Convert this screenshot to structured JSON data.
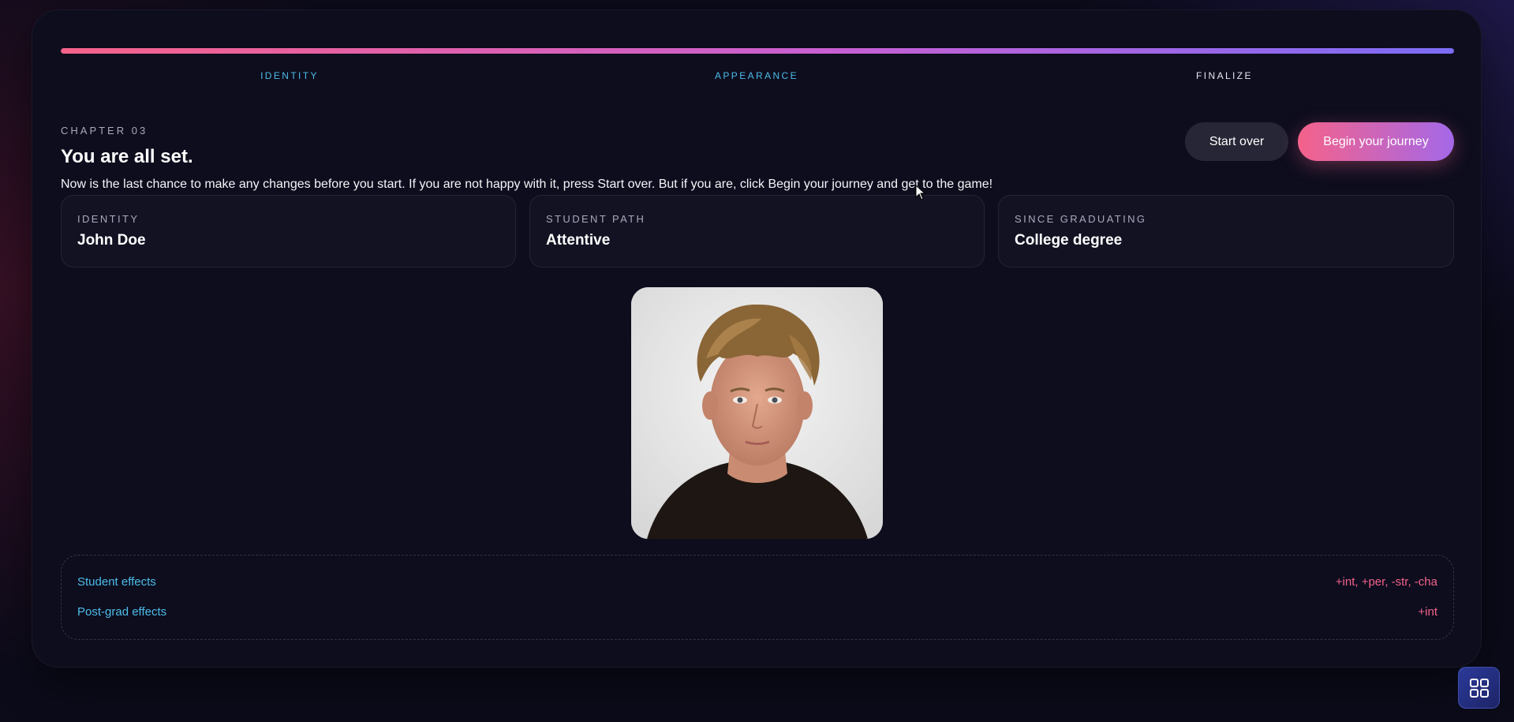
{
  "progress": {
    "fraction": 1.0,
    "colors": [
      "#f5628a",
      "#7b6cf6"
    ]
  },
  "steps": [
    {
      "label": "IDENTITY",
      "state": "done"
    },
    {
      "label": "APPEARANCE",
      "state": "done"
    },
    {
      "label": "FINALIZE",
      "state": "current"
    }
  ],
  "header": {
    "chapter": "CHAPTER 03",
    "title": "You are all set.",
    "description": "Now is the last chance to make any changes before you start. If you are not happy with it, press Start over. But if you are, click Begin your journey and get to the game!"
  },
  "actions": {
    "start_over": "Start over",
    "begin": "Begin your journey"
  },
  "summary": [
    {
      "label": "IDENTITY",
      "value": "John Doe"
    },
    {
      "label": "STUDENT PATH",
      "value": "Attentive"
    },
    {
      "label": "SINCE GRADUATING",
      "value": "College degree"
    }
  ],
  "portrait": {
    "icon": "portrait-photo"
  },
  "effects": [
    {
      "name": "Student effects",
      "value": "+int, +per, -str, -cha"
    },
    {
      "name": "Post-grad effects",
      "value": "+int"
    }
  ],
  "colors": {
    "accent_pink": "#f5628a",
    "accent_violet": "#7b6cf6",
    "accent_cyan": "#4dbce8"
  },
  "corner_button": {
    "icon": "grid-icon"
  }
}
